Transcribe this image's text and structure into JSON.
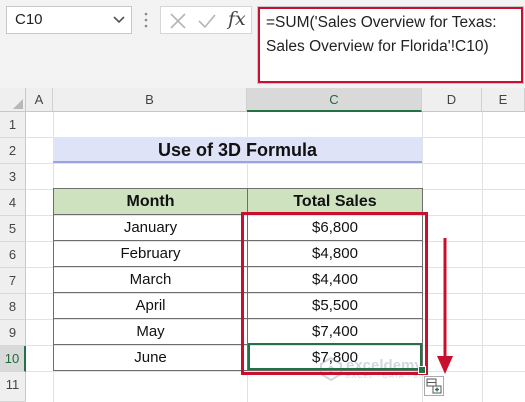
{
  "name_box": {
    "value": "C10"
  },
  "formula_bar": {
    "fx_label": "fx",
    "line1": "=SUM('Sales Overview for Texas:",
    "line2": "Sales Overview for Florida'!C10)"
  },
  "columns": [
    "A",
    "B",
    "C",
    "D",
    "E"
  ],
  "rows": [
    "1",
    "2",
    "3",
    "4",
    "5",
    "6",
    "7",
    "8",
    "9",
    "10",
    "11"
  ],
  "sheet": {
    "title": "Use of 3D Formula",
    "headers": {
      "month": "Month",
      "total_sales": "Total Sales"
    },
    "data": [
      {
        "month": "January",
        "sales": "$6,800"
      },
      {
        "month": "February",
        "sales": "$4,800"
      },
      {
        "month": "March",
        "sales": "$4,400"
      },
      {
        "month": "April",
        "sales": "$5,500"
      },
      {
        "month": "May",
        "sales": "$7,400"
      },
      {
        "month": "June",
        "sales": "$7,800"
      }
    ]
  },
  "watermark": {
    "name": "exceldemy",
    "tagline": "EXCEL · DATA · BI"
  },
  "colors": {
    "highlight": "#c8102e",
    "selection": "#217346",
    "header_fill": "#cfe2c0",
    "title_fill": "#dfe3f7"
  }
}
